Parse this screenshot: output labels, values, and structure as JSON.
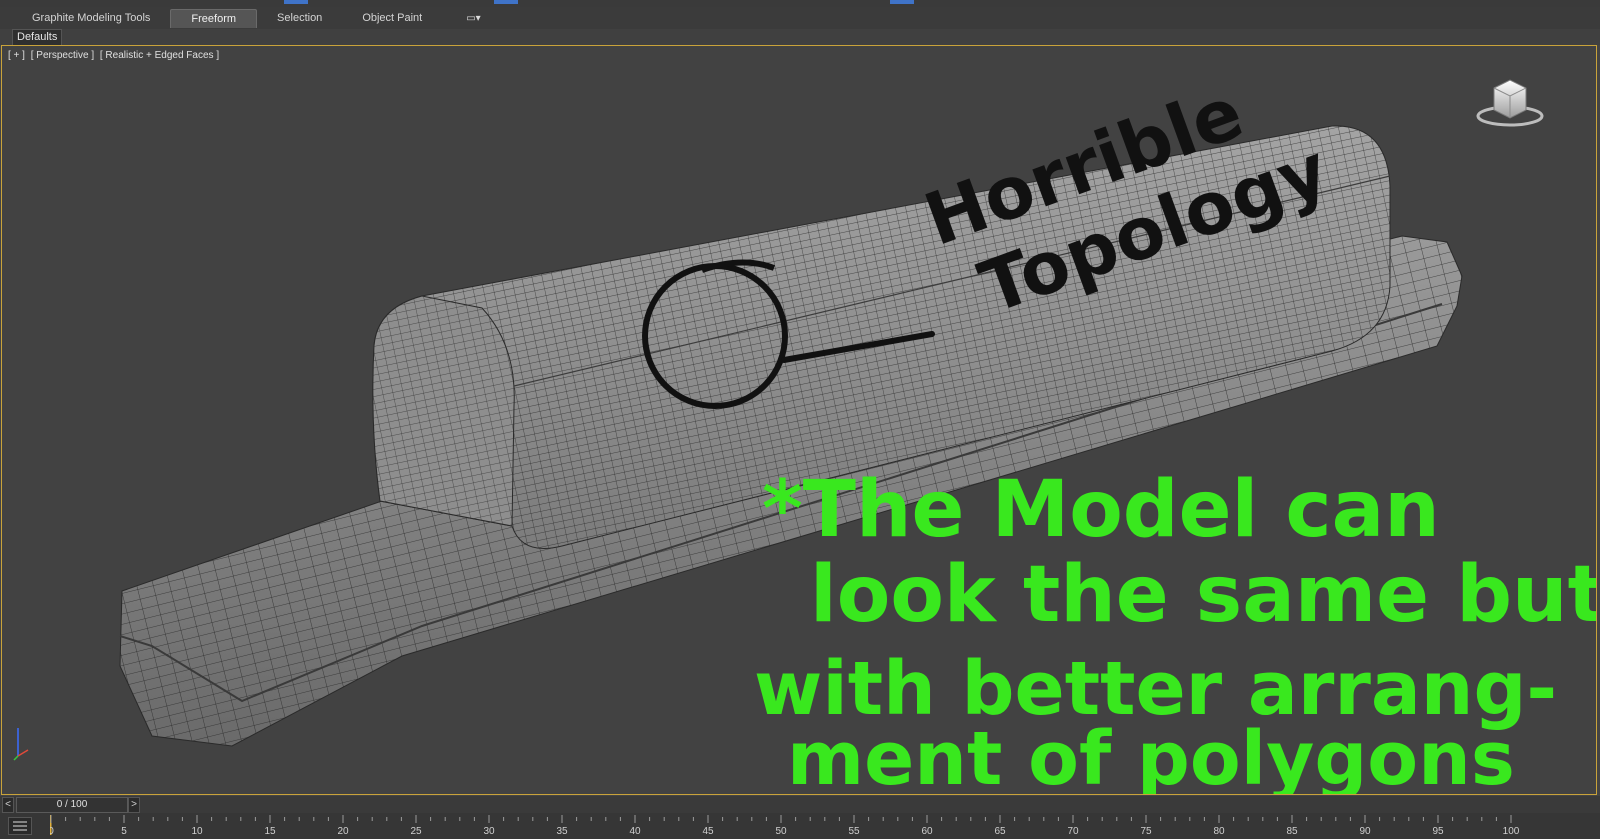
{
  "ribbon": {
    "tabs": [
      {
        "label": "Graphite Modeling Tools",
        "active": false
      },
      {
        "label": "Freeform",
        "active": true
      },
      {
        "label": "Selection",
        "active": false
      },
      {
        "label": "Object Paint",
        "active": false
      }
    ],
    "options_icon": "ribbon-options-icon"
  },
  "defaults_label": "Defaults",
  "viewport": {
    "label_parts": [
      "[ + ]",
      "[ Perspective ]",
      "[ Realistic + Edged Faces ]"
    ],
    "viewcube_icon": "viewcube-icon",
    "axis_icon": "axis-tripod-icon"
  },
  "annotations": {
    "black_lines": [
      "Horrible",
      "Topology"
    ],
    "green_lines": [
      "*The Model can",
      "look the same but",
      "with better arrang-",
      "ment of polygons"
    ],
    "ink_colors": {
      "black": "#111111",
      "green": "#39e81e"
    }
  },
  "time_slider": {
    "frame": "0 / 100",
    "prev": "<",
    "next": ">"
  },
  "trackbar": {
    "ticks": [
      "0",
      "5",
      "10",
      "15",
      "20",
      "25",
      "30",
      "35",
      "40",
      "45",
      "50",
      "55",
      "60",
      "65",
      "70",
      "75",
      "80",
      "85",
      "90",
      "95",
      "100"
    ],
    "key_icon": "key-filters-icon"
  },
  "colors": {
    "viewport_border": "#c9a33a",
    "model": "#8a8a8a"
  }
}
